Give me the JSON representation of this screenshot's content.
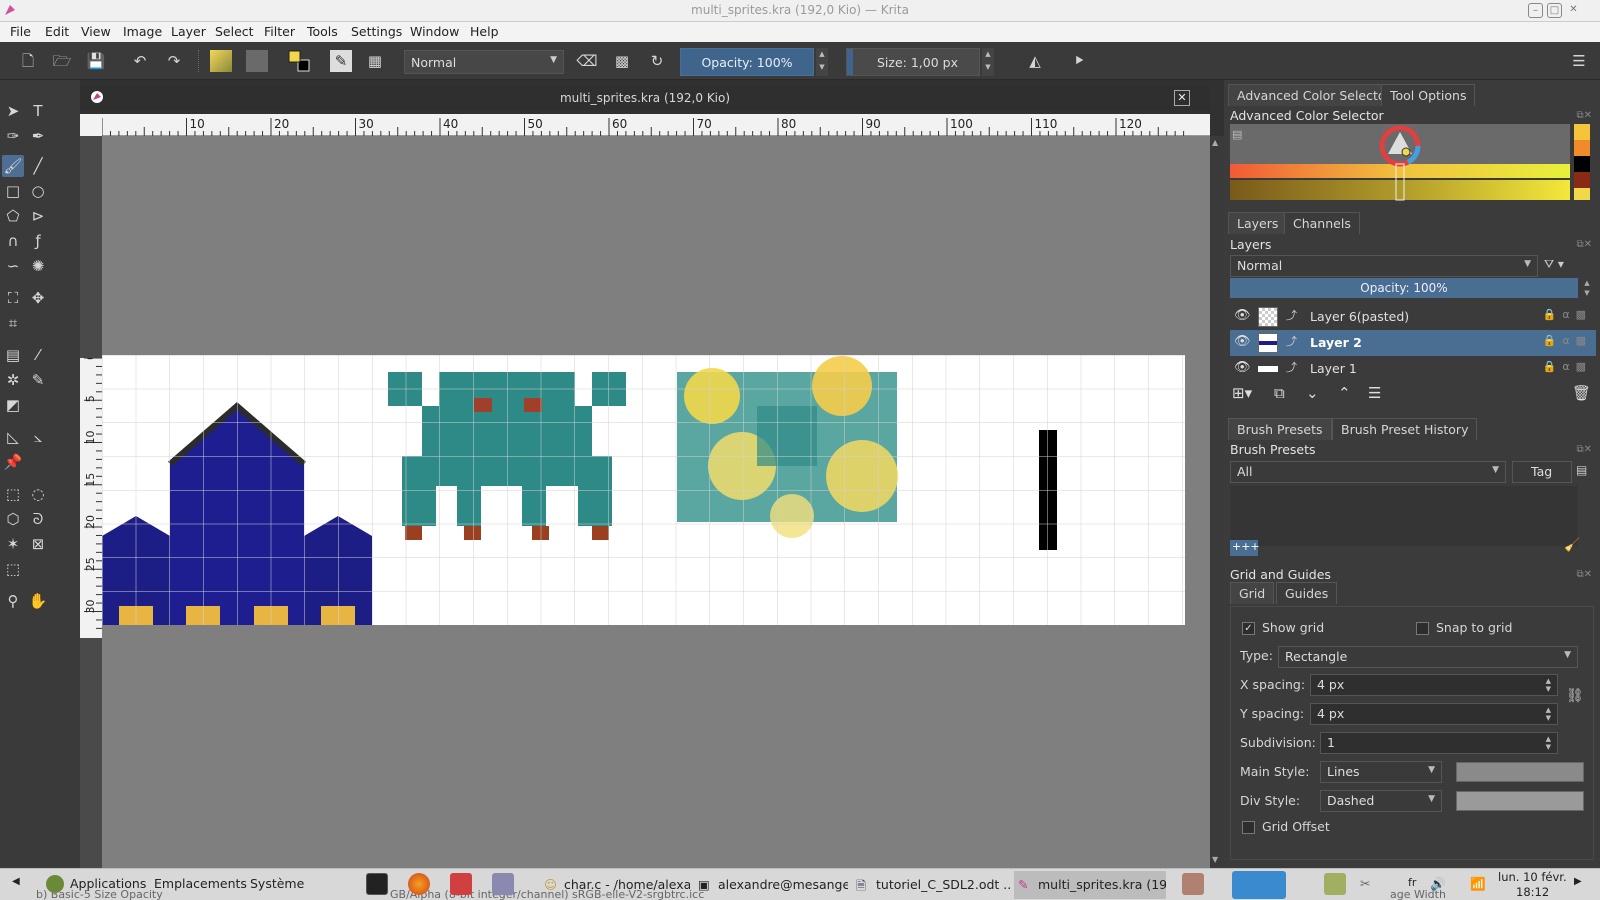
{
  "window": {
    "title": "multi_sprites.kra (192,0 Kio) — Krita"
  },
  "menu": [
    "File",
    "Edit",
    "View",
    "Image",
    "Layer",
    "Select",
    "Filter",
    "Tools",
    "Settings",
    "Window",
    "Help"
  ],
  "toolbar": {
    "blend_mode": "Normal",
    "opacity": "Opacity: 100%",
    "size": "Size: 1,00 px"
  },
  "document": {
    "tab_title": "multi_sprites.kra (192,0 Kio)",
    "ruler_h_ticks": [
      "10",
      "20",
      "30",
      "40",
      "50",
      "60",
      "70",
      "80",
      "90",
      "100",
      "110",
      "120"
    ],
    "ruler_v_ticks": [
      "0",
      "5",
      "10",
      "15",
      "20",
      "25",
      "30"
    ]
  },
  "docker": {
    "color_tabs": [
      "Advanced Color Selector",
      "Tool Options"
    ],
    "color_title": "Advanced Color Selector",
    "layers_tabs": [
      "Layers",
      "Channels"
    ],
    "layers_title": "Layers",
    "layers_blend": "Normal",
    "layers_opacity": "Opacity:  100%",
    "layers": [
      {
        "name": "Layer 6(pasted)",
        "selected": false
      },
      {
        "name": "Layer 2",
        "selected": true
      },
      {
        "name": "Layer 1",
        "selected": false
      }
    ],
    "brush_tabs": [
      "Brush Presets",
      "Brush Preset History"
    ],
    "brush_title": "Brush Presets",
    "brush_filter": "All",
    "brush_tag": "Tag",
    "brush_search": "+++",
    "grid_title": "Grid and Guides",
    "grid_tabs": [
      "Grid",
      "Guides"
    ],
    "show_grid": "Show grid",
    "snap_to_grid": "Snap to grid",
    "type_label": "Type:",
    "type_value": "Rectangle",
    "x_spacing_label": "X spacing:",
    "x_spacing": "4 px",
    "y_spacing_label": "Y spacing:",
    "y_spacing": "4 px",
    "subdivision_label": "Subdivision:",
    "subdivision": "1",
    "main_style_label": "Main Style:",
    "main_style": "Lines",
    "div_style_label": "Div Style:",
    "div_style": "Dashed",
    "grid_offset": "Grid Offset"
  },
  "taskbar": {
    "menus": [
      "Applications",
      "Emplacements",
      "Système"
    ],
    "windows": [
      "char.c - /home/alexa...",
      "alexandre@mesange:...",
      "tutoriel_C_SDL2.odt ...",
      "multi_sprites.kra (19..."
    ],
    "keyboard": "fr",
    "date": "lun. 10 févr.",
    "time": "18:12",
    "status_ghost_left": "b) Basic-5 Size Opacity",
    "status_ghost_mid": "GB/Alpha (8-bit integer/channel)  sRGB-elle-V2-srgbtrc.icc",
    "status_ghost_right": "age Width"
  },
  "colors": {
    "accent": "#4a6d92",
    "canvas": "#7f7f7f",
    "sprite_blue": "#1c1c8a",
    "sprite_teal": "#2e8a86",
    "sprite_yellow": "#f1d84a"
  }
}
